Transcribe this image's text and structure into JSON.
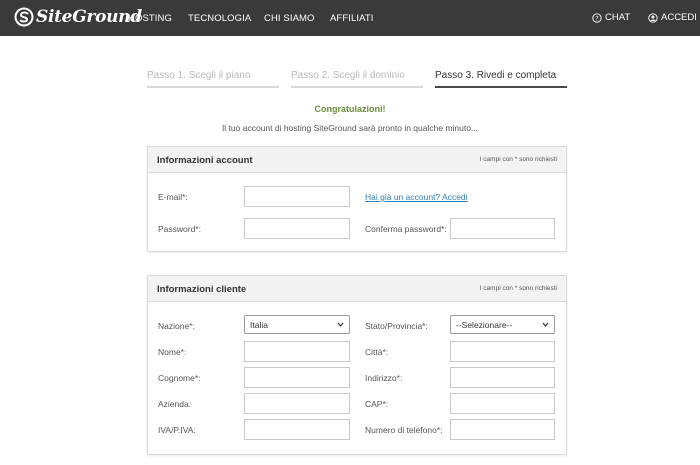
{
  "brand": {
    "name": "SiteGround"
  },
  "nav": {
    "items": [
      "HOSTING",
      "TECNOLOGIA",
      "CHI SIAMO",
      "AFFILIATI"
    ],
    "chat": "CHAT",
    "login": "ACCEDI"
  },
  "steps": [
    {
      "label": "Passo 1. Scegli il piano",
      "active": false
    },
    {
      "label": "Passo 2. Scegli il dominio",
      "active": false
    },
    {
      "label": "Passo 3. Rivedi e completa",
      "active": true
    }
  ],
  "congrats": "Congratulazioni!",
  "subtitle": "Il tuo account di hosting SiteGround sarà pronto in qualche minuto...",
  "account_panel": {
    "title": "Informazioni account",
    "note": "I campi con * sono richiesti",
    "email_label": "E-mail*:",
    "email_value": "",
    "password_label": "Password*:",
    "password_value": "",
    "existing_link": "Hai già un account? Accedi",
    "confirm_label": "Conferma password*:",
    "confirm_value": ""
  },
  "client_panel": {
    "title": "Informazioni cliente",
    "note": "I campi con * sono richiesti",
    "country_label": "Nazione*:",
    "country_value": "Italia",
    "state_label": "Stato/Provincia*:",
    "state_value": "--Selezionare--",
    "first_name_label": "Nome*:",
    "city_label": "Città*:",
    "last_name_label": "Cognome*:",
    "address_label": "Indirizzo*:",
    "company_label": "Azienda:",
    "zip_label": "CAP*:",
    "vat_label": "IVA/P.IVA:",
    "phone_label": "Numero di telefono*:"
  },
  "colors": {
    "topbar": "#3a3a3a",
    "accent_green": "#6b8f3a",
    "link": "#2f7fb8"
  }
}
